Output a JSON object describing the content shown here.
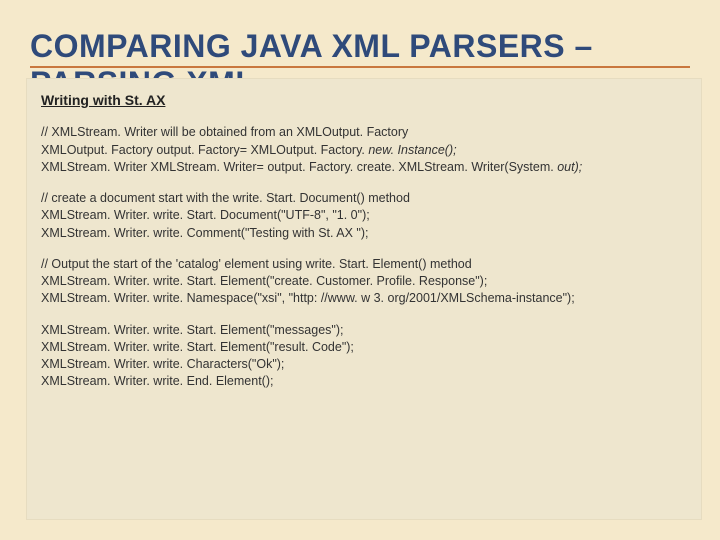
{
  "title": "COMPARING JAVA XML PARSERS – PARSING XML",
  "heading": "Writing with St. AX",
  "blocks": {
    "b1": {
      "l1": "// XMLStream. Writer will be obtained from an XMLOutput. Factory",
      "l2a": "XMLOutput. Factory output. Factory= XMLOutput. Factory. ",
      "l2b": "new. Instance();",
      "l3a": "XMLStream. Writer XMLStream. Writer= output. Factory. create. XMLStream. Writer(System. ",
      "l3b": "out);"
    },
    "b2": {
      "l1": "// create a document start with the write. Start. Document() method",
      "l2": "XMLStream. Writer. write. Start. Document(\"UTF-8\", \"1. 0\");",
      "l3": "XMLStream. Writer. write. Comment(\"Testing with St. AX \");"
    },
    "b3": {
      "l1": "// Output the start of the 'catalog' element using write. Start. Element() method",
      "l2": "XMLStream. Writer. write. Start. Element(\"create. Customer. Profile. Response\");",
      "l3": "XMLStream. Writer. write. Namespace(\"xsi\", \"http: //www. w 3. org/2001/XMLSchema-instance\");"
    },
    "b4": {
      "l1": "XMLStream. Writer. write. Start. Element(\"messages\");",
      "l2": "XMLStream. Writer. write. Start. Element(\"result. Code\");",
      "l3": "XMLStream. Writer. write. Characters(\"Ok\");",
      "l4": "XMLStream. Writer. write. End. Element();"
    }
  }
}
